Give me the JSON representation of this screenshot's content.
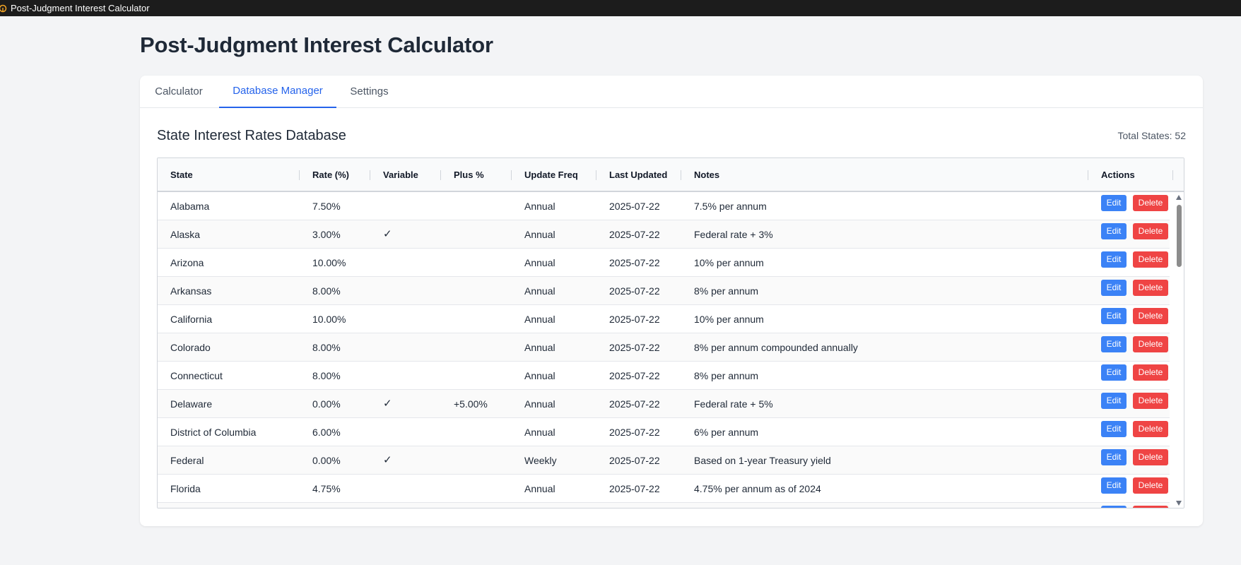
{
  "window": {
    "title": "Post-Judgment Interest Calculator"
  },
  "page": {
    "title": "Post-Judgment Interest Calculator"
  },
  "tabs": [
    {
      "label": "Calculator",
      "active": false
    },
    {
      "label": "Database Manager",
      "active": true
    },
    {
      "label": "Settings",
      "active": false
    }
  ],
  "database": {
    "title": "State Interest Rates Database",
    "total_states": "Total States: 52",
    "columns": [
      "State",
      "Rate (%)",
      "Variable",
      "Plus %",
      "Update Freq",
      "Last Updated",
      "Notes",
      "Actions"
    ],
    "actions": {
      "edit_label": "Edit",
      "delete_label": "Delete"
    },
    "rows": [
      {
        "state": "Alabama",
        "rate": "7.50%",
        "variable": "",
        "plus": "",
        "freq": "Annual",
        "updated": "2025-07-22",
        "notes": "7.5% per annum"
      },
      {
        "state": "Alaska",
        "rate": "3.00%",
        "variable": "✓",
        "plus": "",
        "freq": "Annual",
        "updated": "2025-07-22",
        "notes": "Federal rate + 3%"
      },
      {
        "state": "Arizona",
        "rate": "10.00%",
        "variable": "",
        "plus": "",
        "freq": "Annual",
        "updated": "2025-07-22",
        "notes": "10% per annum"
      },
      {
        "state": "Arkansas",
        "rate": "8.00%",
        "variable": "",
        "plus": "",
        "freq": "Annual",
        "updated": "2025-07-22",
        "notes": "8% per annum"
      },
      {
        "state": "California",
        "rate": "10.00%",
        "variable": "",
        "plus": "",
        "freq": "Annual",
        "updated": "2025-07-22",
        "notes": "10% per annum"
      },
      {
        "state": "Colorado",
        "rate": "8.00%",
        "variable": "",
        "plus": "",
        "freq": "Annual",
        "updated": "2025-07-22",
        "notes": "8% per annum compounded annually"
      },
      {
        "state": "Connecticut",
        "rate": "8.00%",
        "variable": "",
        "plus": "",
        "freq": "Annual",
        "updated": "2025-07-22",
        "notes": "8% per annum"
      },
      {
        "state": "Delaware",
        "rate": "0.00%",
        "variable": "✓",
        "plus": "+5.00%",
        "freq": "Annual",
        "updated": "2025-07-22",
        "notes": "Federal rate + 5%"
      },
      {
        "state": "District of Columbia",
        "rate": "6.00%",
        "variable": "",
        "plus": "",
        "freq": "Annual",
        "updated": "2025-07-22",
        "notes": "6% per annum"
      },
      {
        "state": "Federal",
        "rate": "0.00%",
        "variable": "✓",
        "plus": "",
        "freq": "Weekly",
        "updated": "2025-07-22",
        "notes": "Based on 1-year Treasury yield"
      },
      {
        "state": "Florida",
        "rate": "4.75%",
        "variable": "",
        "plus": "",
        "freq": "Annual",
        "updated": "2025-07-22",
        "notes": "4.75% per annum as of 2024"
      },
      {
        "state": "",
        "rate": "",
        "variable": "",
        "plus": "",
        "freq": "",
        "updated": "",
        "notes": ""
      }
    ]
  },
  "colors": {
    "accent": "#2563eb",
    "edit_button": "#3b82f6",
    "delete_button": "#ef4444",
    "titlebar": "#1c1c1c",
    "background": "#f3f4f6"
  },
  "icons": {
    "app": "scale-icon",
    "scroll_up": "arrow-up-icon",
    "scroll_down": "arrow-down-icon",
    "variable": "checkmark-icon"
  }
}
